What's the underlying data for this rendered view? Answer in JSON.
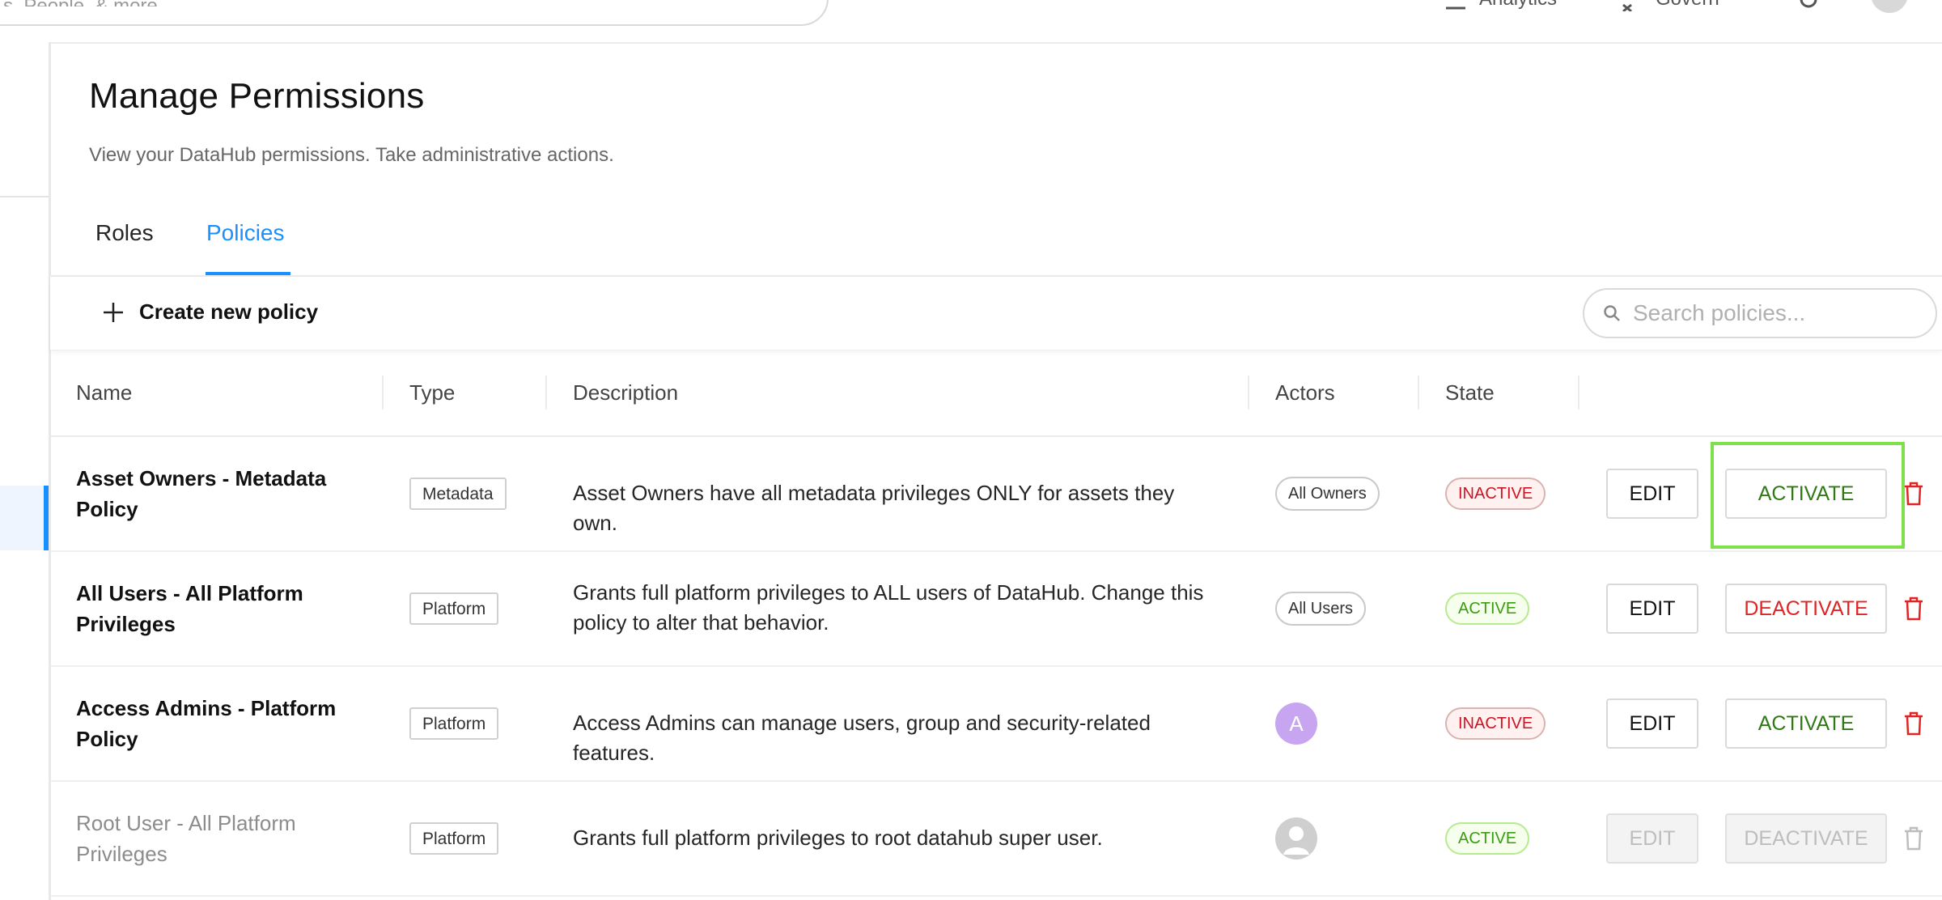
{
  "header": {
    "search_placeholder": "s, People, & more...",
    "analytics_label": "Analytics",
    "govern_label": "Govern",
    "analytics_icon": "chart-icon",
    "govern_icon": "govern-icon",
    "settings_icon": "gear-icon"
  },
  "page": {
    "title": "Manage Permissions",
    "subtitle": "View your DataHub permissions. Take administrative actions."
  },
  "tabs": [
    {
      "label": "Roles",
      "active": false
    },
    {
      "label": "Policies",
      "active": true
    }
  ],
  "toolbar": {
    "create_label": "Create new policy",
    "search_placeholder": "Search policies..."
  },
  "table": {
    "columns": [
      "Name",
      "Type",
      "Description",
      "Actors",
      "State"
    ],
    "rows": [
      {
        "name": "Asset Owners - Metadata Policy",
        "type": "Metadata",
        "description": "Asset Owners have all metadata privileges ONLY for assets they own.",
        "actors": "All Owners",
        "state": "INACTIVE",
        "edit_label": "EDIT",
        "action_label": "ACTIVATE"
      },
      {
        "name": "All Users - All Platform Privileges",
        "type": "Platform",
        "description": "Grants full platform privileges to ALL users of DataHub. Change this policy to alter that behavior.",
        "actors": "All Users",
        "state": "ACTIVE",
        "edit_label": "EDIT",
        "action_label": "DEACTIVATE"
      },
      {
        "name": "Access Admins - Platform Policy",
        "type": "Platform",
        "description": "Access Admins can manage users, group and security-related features.",
        "actors": "A",
        "state": "INACTIVE",
        "edit_label": "EDIT",
        "action_label": "ACTIVATE"
      },
      {
        "name": "Root User - All Platform Privileges",
        "type": "Platform",
        "description": "Grants full platform privileges to root datahub super user.",
        "actors": "",
        "state": "ACTIVE",
        "edit_label": "EDIT",
        "action_label": "DEACTIVATE",
        "disabled": true
      }
    ]
  },
  "colors": {
    "accent": "#1890ff",
    "activate": "#2f7a14",
    "deactivate": "#e02424",
    "highlight": "#7ee04a"
  }
}
